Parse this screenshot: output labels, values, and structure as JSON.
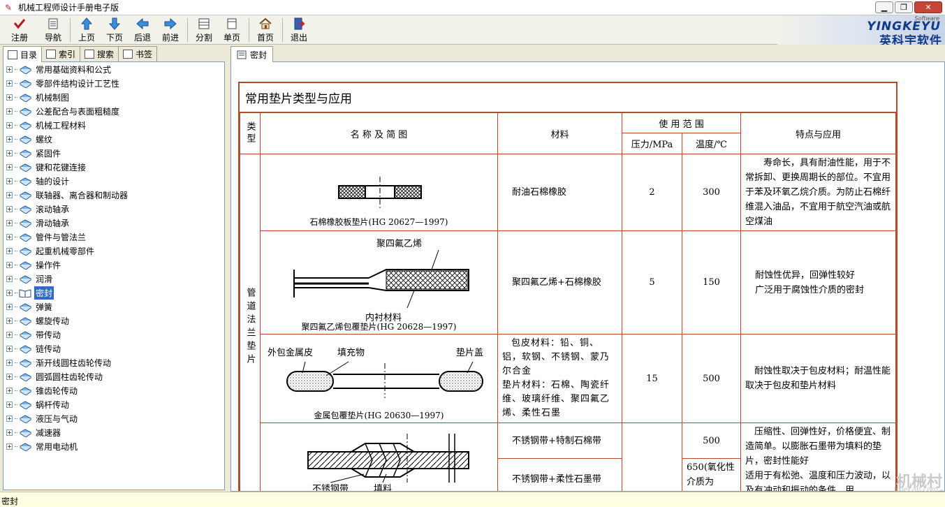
{
  "window": {
    "title": "机械工程师设计手册电子版",
    "btn_minimize": "▁",
    "btn_restore": "❐",
    "btn_close": "✕"
  },
  "toolbar": {
    "items": [
      {
        "label": "注册",
        "icon": "checkmark-icon"
      },
      {
        "label": "导航",
        "icon": "panel-icon"
      },
      {
        "label": "上页",
        "icon": "arrow-up-icon"
      },
      {
        "label": "下页",
        "icon": "arrow-down-icon"
      },
      {
        "label": "后退",
        "icon": "arrow-left-icon"
      },
      {
        "label": "前进",
        "icon": "arrow-right-icon"
      },
      {
        "label": "分割",
        "icon": "split-icon"
      },
      {
        "label": "单页",
        "icon": "page-icon"
      },
      {
        "label": "首页",
        "icon": "home-icon"
      },
      {
        "label": "退出",
        "icon": "exit-icon"
      }
    ]
  },
  "brand": {
    "software": "Software",
    "name_en": "YINGKEYU",
    "name_cn": "英科宇软件"
  },
  "left_tabs": [
    "目录",
    "索引",
    "搜索",
    "书签"
  ],
  "tree": {
    "items": [
      "常用基础资料和公式",
      "零部件结构设计工艺性",
      "机械制图",
      "公差配合与表面粗糙度",
      "机械工程材料",
      "螺纹",
      "紧固件",
      "键和花键连接",
      "轴的设计",
      "联轴器、离合器和制动器",
      "滚动轴承",
      "滑动轴承",
      "管件与管法兰",
      "起重机械零部件",
      "操作件",
      "润滑",
      "密封",
      "弹簧",
      "螺旋传动",
      "带传动",
      "链传动",
      "渐开线圆柱齿轮传动",
      "圆弧圆柱齿轮传动",
      "锥齿轮传动",
      "蜗杆传动",
      "液压与气动",
      "减速器",
      "常用电动机"
    ],
    "selected": "密封"
  },
  "content_tab": "密封",
  "table": {
    "title": "常用垫片类型与应用",
    "headers": {
      "type": "类型",
      "name": "名 称 及 简 图",
      "material": "材料",
      "range": "使 用 范 围",
      "pressure": "压力/MPa",
      "temperature": "温度/℃",
      "features": "特点与应用"
    },
    "type_label": "管道法兰垫片",
    "rows": [
      {
        "caption": "石棉橡胶板垫片(HG 20627—1997)",
        "material": "耐油石棉橡胶",
        "pressure": "2",
        "temperature": "300",
        "features": "寿命长，具有耐油性能，用于不常拆卸、更换周期长的部位。不宜用于苯及环氧乙烷介质。为防止石棉纤维混入油品，不宜用于航空汽油或航空煤油"
      },
      {
        "caption": "聚四氟乙烯包覆垫片(HG 20628—1997)",
        "label_top": "聚四氟乙烯",
        "label_bottom": "内衬材料",
        "material": "聚四氟乙烯+石棉橡胶",
        "pressure": "5",
        "temperature": "150",
        "features": "耐蚀性优异，回弹性较好\n广泛用于腐蚀性介质的密封"
      },
      {
        "caption": "金属包覆垫片(HG 20630—1997)",
        "label_left": "外包金属皮",
        "label_mid": "填充物",
        "label_right": "垫片盖",
        "material": "包皮材料：铅、铜、铝，软钢、不锈钢、蒙乃尔合金\n垫片材料：石棉、陶瓷纤维、玻璃纤维、聚四氟乙烯、柔性石墨",
        "pressure": "15",
        "temperature": "500",
        "features": "耐蚀性取决于包皮材料；耐温性能取决于包皮和垫片材料"
      },
      {
        "label_left": "不锈钢带",
        "label_right": "填料",
        "material_a": "不锈钢带+特制石棉带",
        "temperature_a": "500",
        "material_b": "不锈钢带+柔性石墨带",
        "temperature_b": "650(氧化性介质为",
        "features": "压缩性、回弹性好，价格便宜、制造简单。以膨胀石墨带为填料的垫片，密封性能好\n适用于有松弛、温度和压力波动，以及有冲动和振动的条件，用"
      }
    ]
  },
  "status": {
    "text": "密封"
  },
  "watermark": {
    "cn": "机械村",
    "en": "Jixiecun.com"
  },
  "colors": {
    "table_border": "#b34a2a",
    "selection": "#316ac5",
    "brand_blue": "#123a8a"
  }
}
